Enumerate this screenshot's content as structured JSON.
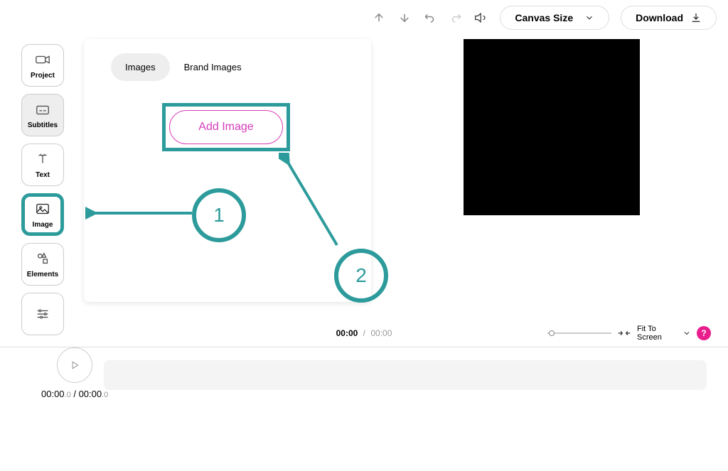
{
  "toolbar": {
    "canvas_size": "Canvas Size",
    "download": "Download"
  },
  "sidebar": {
    "items": [
      {
        "label": "Project"
      },
      {
        "label": "Subtitles"
      },
      {
        "label": "Text"
      },
      {
        "label": "Image"
      },
      {
        "label": "Elements"
      }
    ]
  },
  "panel": {
    "tabs": [
      {
        "label": "Images"
      },
      {
        "label": "Brand Images"
      }
    ],
    "add_button": "Add Image"
  },
  "callouts": {
    "one": "1",
    "two": "2"
  },
  "timeline": {
    "current": "00:00",
    "sep": "/",
    "duration": "00:00",
    "fit_label": "Fit To Screen",
    "help": "?"
  },
  "playbar": {
    "cur_main": "00:00",
    "cur_sub": ".0",
    "sep": " / ",
    "dur_main": "00:00",
    "dur_sub": ".0"
  }
}
